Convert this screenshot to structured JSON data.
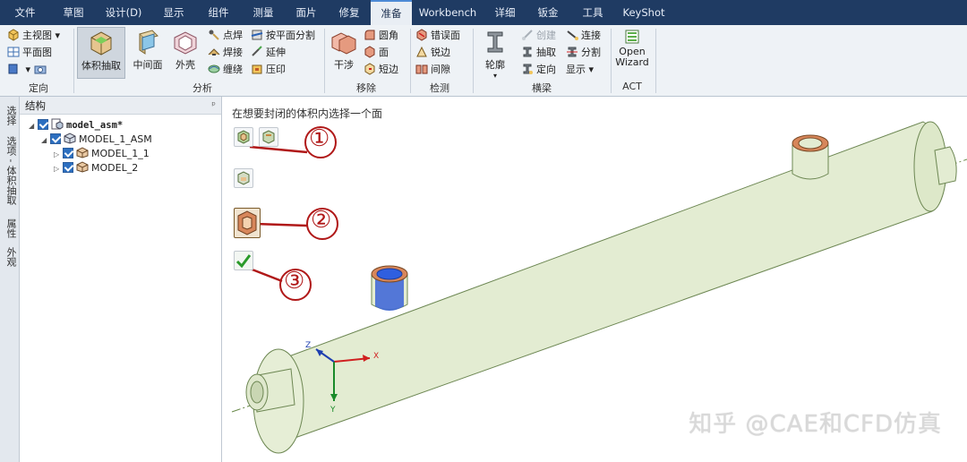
{
  "menu": {
    "tabs": [
      "文件",
      "草图",
      "设计(D)",
      "显示",
      "组件",
      "测量",
      "面片",
      "修复",
      "准备",
      "Workbench",
      "详细",
      "钣金",
      "工具",
      "KeyShot"
    ],
    "active_index": 8
  },
  "ribbon": {
    "orient": {
      "main_view": "主视图",
      "plane_view": "平面图",
      "group": "定向"
    },
    "analyze": {
      "volume_extract": "体积抽取",
      "midsurface": "中间面",
      "shell": "外壳",
      "spot_weld": "点焊",
      "weld": "焊接",
      "wrap": "缠绕",
      "split_by_plane": "按平面分割",
      "extend": "延伸",
      "imprint": "压印",
      "group": "分析"
    },
    "remove": {
      "interference": "干涉",
      "round": "圆角",
      "face": "面",
      "short_edge": "短边",
      "group": "移除"
    },
    "detect": {
      "error_edge": "错误面",
      "sharp_edge": "锐边",
      "gap": "间隙",
      "group": "检测"
    },
    "beam": {
      "profile": "轮廓",
      "create": "创建",
      "extract": "抽取",
      "orient": "定向",
      "connect": "连接",
      "split": "分割",
      "display": "显示",
      "group": "横梁"
    },
    "act": {
      "open": "Open",
      "wizard": "Wizard",
      "group": "ACT"
    }
  },
  "side_tabs": [
    "选择",
    "选项 - 体积抽取",
    "属性",
    "外观"
  ],
  "structure": {
    "title": "结构",
    "pin": "ᵖ",
    "tree": [
      {
        "label": "model_asm*",
        "level": 0
      },
      {
        "label": "MODEL_1_ASM",
        "level": 1
      },
      {
        "label": "MODEL_1_1",
        "level": 2
      },
      {
        "label": "MODEL_2",
        "level": 2
      }
    ]
  },
  "viewport": {
    "prompt": "在想要封闭的体积内选择一个面",
    "annotations": [
      "①",
      "②",
      "③"
    ],
    "axes": {
      "x": "X",
      "y": "Y",
      "z": "Z"
    },
    "watermark": "知乎 @CAE和CFD仿真"
  },
  "colors": {
    "menubar": "#1f3b63",
    "model": "#e3ecd2",
    "annotation": "#b01818"
  }
}
